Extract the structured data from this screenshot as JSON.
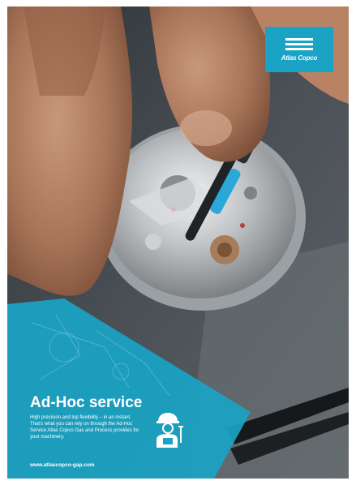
{
  "brand": {
    "logo_text": "Atlas Copco",
    "accent_color": "#1aa3c4"
  },
  "panel": {
    "title": "Ad-Hoc service",
    "body": "High precision and top flexibility – in an instant. That's what you can rely on through the Ad-Hoc Service Atlas Copco Gas and Process provides for your machinery.",
    "website": "www.atlascopco-gap.com",
    "icon": "technician-tools-icon"
  }
}
